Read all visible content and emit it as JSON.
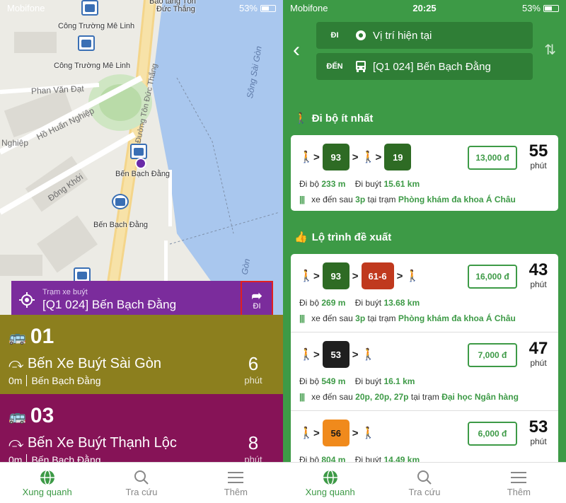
{
  "left": {
    "status": {
      "carrier": "Mobifone",
      "battery": "53%"
    },
    "map": {
      "places": [
        "Công Trường Mê Linh",
        "Công Trường Mê Linh",
        "Bến Bạch Đằng",
        "Bến Bạch Đằng",
        "Bảo tàng Tôn",
        "Đức Thắng"
      ],
      "streets": [
        "Phan Văn Đạt",
        "Hồ Huấn Nghiệp",
        "Đông Khởi",
        "Đường Tôn Đức Thắng",
        "Nghiệp"
      ],
      "river": [
        "Sông Sài Gòn",
        "Gòn"
      ]
    },
    "stop": {
      "caption": "Trạm xe buýt",
      "name": "[Q1 024] Bến Bạch Đằng",
      "go_label": "ĐI"
    },
    "routes": [
      {
        "number": "01",
        "destination": "Bến Xe Buýt Sài Gòn",
        "minutes": "6",
        "unit": "phút",
        "distance": "0m",
        "stop": "Bến Bạch Đằng",
        "color": "#8c7f1e"
      },
      {
        "number": "03",
        "destination": "Bến Xe Buýt Thạnh Lộc",
        "minutes": "8",
        "unit": "phút",
        "distance": "0m",
        "stop": "Bến Bạch Đằng",
        "color": "#861357"
      }
    ],
    "tabs": [
      {
        "label": "Xung quanh",
        "icon": "globe-icon",
        "active": true
      },
      {
        "label": "Tra cứu",
        "icon": "search-icon",
        "active": false
      },
      {
        "label": "Thêm",
        "icon": "menu-icon",
        "active": false
      }
    ]
  },
  "right": {
    "status": {
      "carrier": "Mobifone",
      "time": "20:25",
      "battery": "53%"
    },
    "from": {
      "label": "ĐI",
      "value": "Vị trí hiện tại"
    },
    "to": {
      "label": "ĐẾN",
      "value": "[Q1 024] Bến Bạch Đằng"
    },
    "section1": {
      "title": "Đi bộ ít nhất"
    },
    "section2": {
      "title": "Lộ trình đề xuất"
    },
    "options": [
      {
        "buses": [
          {
            "num": "93",
            "color": "#2e6b24"
          },
          {
            "num": "19",
            "color": "#2e6b24"
          }
        ],
        "price": "13,000 đ",
        "minutes": "55",
        "unit": "phút",
        "walk_label": "Đi bộ",
        "walk": "233 m",
        "bus_label": "Đi buýt",
        "bus_dist": "15.61 km",
        "arrive_prefix": "xe đến sau",
        "arrive": "3p",
        "at_label": "tại trạm",
        "station": "Phòng khám đa khoa Á Châu"
      },
      {
        "buses": [
          {
            "num": "93",
            "color": "#2e6b24"
          },
          {
            "num": "61-6",
            "color": "#c0391e"
          }
        ],
        "price": "16,000 đ",
        "minutes": "43",
        "unit": "phút",
        "walk_label": "Đi bộ",
        "walk": "269 m",
        "bus_label": "Đi buýt",
        "bus_dist": "13.68 km",
        "arrive_prefix": "xe đến sau",
        "arrive": "3p",
        "at_label": "tại trạm",
        "station": "Phòng khám đa khoa Á Châu"
      },
      {
        "buses": [
          {
            "num": "53",
            "color": "#1f1f1f"
          }
        ],
        "price": "7,000 đ",
        "minutes": "47",
        "unit": "phút",
        "walk_label": "Đi bộ",
        "walk": "549 m",
        "bus_label": "Đi buýt",
        "bus_dist": "16.1 km",
        "arrive_prefix": "xe đến sau",
        "arrive": "20p, 20p, 27p",
        "at_label": "tại trạm",
        "station": "Đại học Ngân hàng"
      },
      {
        "buses": [
          {
            "num": "56",
            "color": "#f08a1c"
          }
        ],
        "price": "6,000 đ",
        "minutes": "53",
        "unit": "phút",
        "walk_label": "Đi bộ",
        "walk": "804 m",
        "bus_label": "Đi buýt",
        "bus_dist": "14.49 km"
      }
    ],
    "tabs": [
      {
        "label": "Xung quanh",
        "icon": "globe-icon",
        "active": true
      },
      {
        "label": "Tra cứu",
        "icon": "search-icon",
        "active": false
      },
      {
        "label": "Thêm",
        "icon": "menu-icon",
        "active": false
      }
    ]
  }
}
